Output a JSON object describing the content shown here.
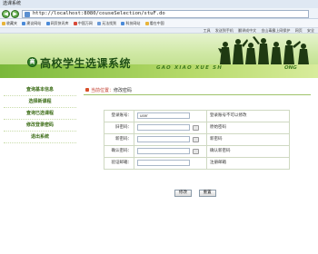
{
  "window": {
    "title": "选课系统"
  },
  "browser": {
    "url": "http://localhost:8080/couseSelection/stuF.do",
    "back_label": "◀",
    "forward_label": "▶",
    "favorites": [
      {
        "label": "收藏夹",
        "color": "#e8b43a"
      },
      {
        "label": "建议网站",
        "color": "#4a8ad8"
      },
      {
        "label": "网页快讯库",
        "color": "#4a8ad8"
      },
      {
        "label": "中国万网",
        "color": "#d84a3a"
      },
      {
        "label": "无法找到",
        "color": "#6a9ad8"
      },
      {
        "label": "科技网站",
        "color": "#4a8ad8"
      },
      {
        "label": "看在中国",
        "color": "#e8b43a"
      }
    ],
    "tools": [
      "工具",
      "发送到手机",
      "翻译成中文",
      "金山毒霸上网保护",
      "网页",
      "安全"
    ]
  },
  "banner": {
    "title": "高校学生选课系统",
    "pinyin": "GAO XIAO XUE SH",
    "pinyin_tail": "ONG",
    "logo_glyph": "高"
  },
  "sidebar": {
    "items": [
      {
        "label": "查询基本信息"
      },
      {
        "label": "选择新课程"
      },
      {
        "label": "查询已选课程"
      },
      {
        "label": "修改登录密码"
      },
      {
        "label": "退出系统"
      }
    ]
  },
  "breadcrumb": {
    "prefix": "当前位置：",
    "current": "修改密码"
  },
  "form": {
    "rows": [
      {
        "label": "登录账号：",
        "value": "user",
        "hint": "登录账号不可以修改",
        "has_kbd": false
      },
      {
        "label": "旧密码：",
        "value": "",
        "hint": "原始密码",
        "has_kbd": true
      },
      {
        "label": "新密码：",
        "value": "",
        "hint": "新密码",
        "has_kbd": true
      },
      {
        "label": "确认密码：",
        "value": "",
        "hint": "确认新密码",
        "has_kbd": true
      },
      {
        "label": "验证邮箱：",
        "value": "",
        "hint": "注册邮箱",
        "has_kbd": false
      }
    ],
    "submit_label": "修改",
    "reset_label": "重置"
  }
}
